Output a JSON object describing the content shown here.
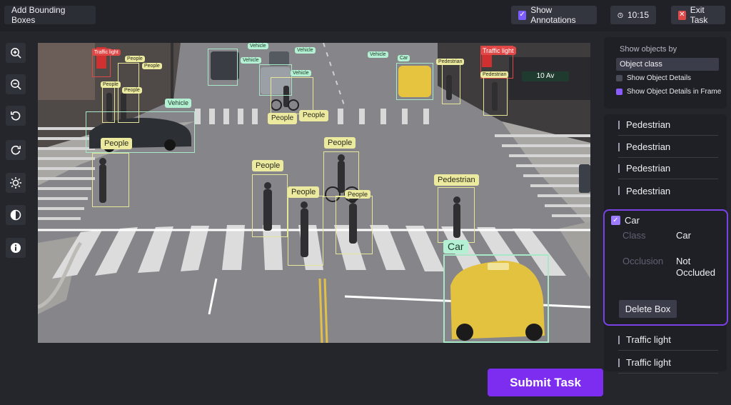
{
  "header": {
    "title": "Add Bounding Boxes",
    "show_annotations": "Show Annotations",
    "timer": "10:15",
    "exit": "Exit Task"
  },
  "toolbar": {
    "tools": [
      "zoom-in-icon",
      "zoom-out-icon",
      "rotate-left-icon",
      "rotate-right-icon",
      "brightness-icon",
      "contrast-icon",
      "info-icon"
    ]
  },
  "canvas": {
    "labels": {
      "people": "People",
      "pedestrian": "Pedestrian",
      "vehicle": "Vehicle",
      "car": "Car",
      "traffic_light": "Traffic light",
      "street_sign": "10 Av"
    }
  },
  "filter": {
    "heading": "Show objects by",
    "selected": "Object class",
    "option1": "Show Object Details",
    "option2": "Show Object Details in Frame"
  },
  "objects": {
    "items": [
      "Pedestrian",
      "Pedestrian",
      "Pedestrian",
      "Pedestrian"
    ],
    "selected": {
      "title": "Car",
      "class_label": "Class",
      "class_value": "Car",
      "occlusion_label": "Occlusion",
      "occlusion_value": "Not Occluded",
      "delete": "Delete Box"
    },
    "after": [
      "Traffic light",
      "Traffic light"
    ]
  },
  "submit": "Submit Task",
  "colors": {
    "accent": "#7c2df0",
    "people_box": "#e7e59a",
    "vehicle_box": "#a6e8c8",
    "traffic_light_box": "#e04848"
  }
}
